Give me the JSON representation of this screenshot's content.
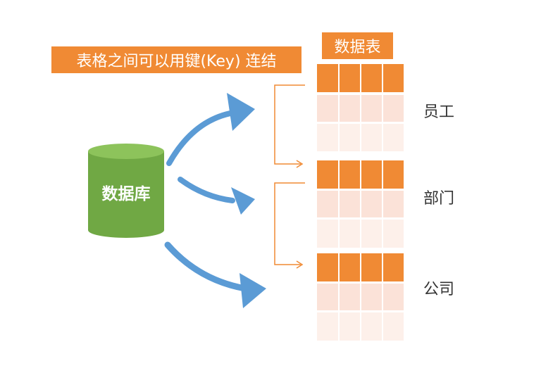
{
  "note": "表格之间可以用键(Key) 连结",
  "table_header": "数据表",
  "database_label": "数据库",
  "tables": [
    {
      "name": "员工"
    },
    {
      "name": "部门"
    },
    {
      "name": "公司"
    }
  ],
  "colors": {
    "orange": "#f08a34",
    "row_light": "#fbe2d8",
    "row_lighter": "#fdf0ea",
    "db_green": "#70a844",
    "db_top": "#8dc35b",
    "arrow_blue": "#5b9bd5"
  }
}
